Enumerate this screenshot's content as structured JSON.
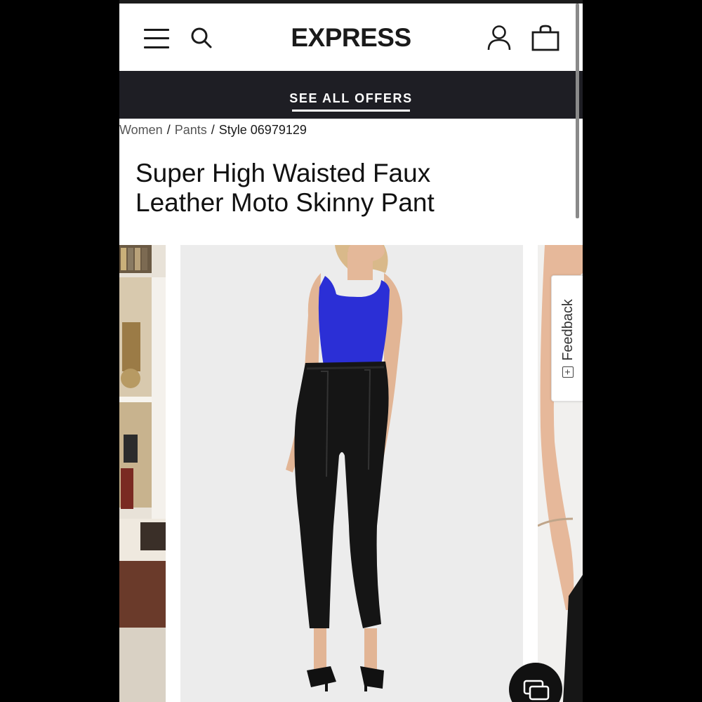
{
  "header": {
    "logo": "EXPRESS",
    "icons": [
      "menu-icon",
      "search-icon",
      "account-icon",
      "bag-icon"
    ]
  },
  "promo_bar": {
    "label": "SEE ALL OFFERS"
  },
  "breadcrumb": {
    "items": [
      "Women",
      "Pants"
    ],
    "current": "Style 06979129"
  },
  "product": {
    "title_line1": "Super High Waisted Faux",
    "title_line2": "Leather Moto Skinny Pant"
  },
  "feedback_tab": {
    "label": "Feedback",
    "icon": "[+]"
  },
  "colors": {
    "brand_black": "#1a1a1a",
    "promo_bg": "#1e1e24",
    "top_blue": "#2b2fd6"
  }
}
